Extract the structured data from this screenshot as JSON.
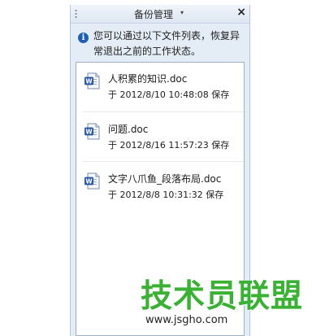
{
  "pane": {
    "title": "备份管理",
    "title_arrow": "▾",
    "close": "×"
  },
  "info": {
    "icon": "i",
    "text": "您可以通过以下文件列表，恢复异常退出之前的工作状态。"
  },
  "files": [
    {
      "name": "人积累的知识.doc",
      "meta": "于 2012/8/10 10:48:08 保存"
    },
    {
      "name": "问题.doc",
      "meta": "于 2012/8/16 11:57:23 保存"
    },
    {
      "name": "文字八爪鱼_段落布局.doc",
      "meta": "于 2012/8/8 10:31:32 保存"
    }
  ],
  "watermark": {
    "brand": "技术员联盟",
    "url": "www.jsgho.com"
  }
}
